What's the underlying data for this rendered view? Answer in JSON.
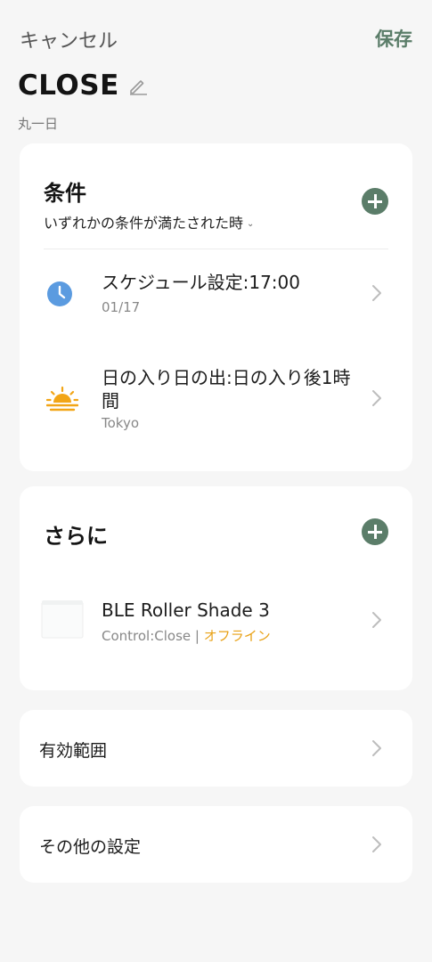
{
  "header": {
    "cancel_label": "キャンセル",
    "save_label": "保存"
  },
  "scene": {
    "title": "CLOSE",
    "subtitle": "丸一日"
  },
  "conditions": {
    "title": "条件",
    "match_mode": "いずれかの条件が満たされた時",
    "items": [
      {
        "label": "スケジュール設定:17:00",
        "sub": "01/17",
        "icon": "clock-icon"
      },
      {
        "label": "日の入り日の出:日の入り後1時間",
        "sub": "Tokyo",
        "icon": "sunset-icon"
      }
    ]
  },
  "actions": {
    "title": "さらに",
    "items": [
      {
        "label": "BLE Roller Shade 3",
        "sub": "Control:Close | ",
        "status": "オフライン",
        "icon": "roller-shade-icon"
      }
    ]
  },
  "effective_period": {
    "label": "有効範囲"
  },
  "other_settings": {
    "label": "その他の設定"
  },
  "colors": {
    "accent": "#5b7d69",
    "offline": "#e8a116",
    "clock": "#5b9be0",
    "sun": "#f2a516"
  }
}
